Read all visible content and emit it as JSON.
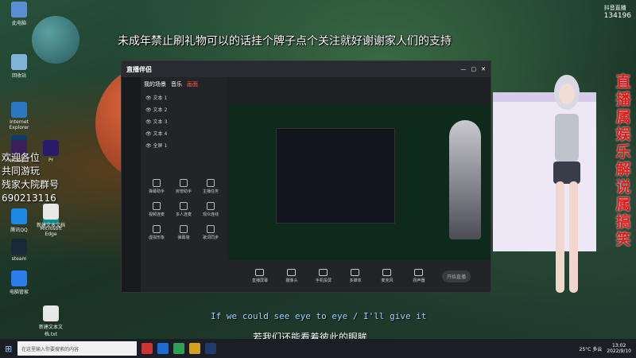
{
  "overlay": {
    "banner_top": "未成年禁止刷礼物可以的话挂个牌子点个关注就好谢谢家人们的支持",
    "left_notice": [
      "欢迎各位",
      "共同游玩",
      "残家大院群号",
      "690213116"
    ],
    "right_vertical": "直播属娱乐解说属搞笑",
    "subtitle_en": "If we could see eye to eye / I'll give it",
    "subtitle_cn": "若我们还能看着彼此的眼眸",
    "watermark_id": "134196"
  },
  "desktop_icons": [
    "此电脑",
    "回收站",
    "Internet Explorer",
    "Adobe Photosh...",
    "Ae",
    "Pr",
    "腾讯QQ",
    "Microsoft Edge",
    "新建文本文档",
    "电脑管家",
    "steam",
    "新建文本文档.txt"
  ],
  "app": {
    "logo": "直播伴侣",
    "tabs": [
      "我的场景",
      "音乐",
      "画面"
    ],
    "scene_items": [
      "文本 1",
      "文本 2",
      "文本 3",
      "文本 4",
      "全屏 1"
    ],
    "tool_items": [
      "弹幕助手",
      "房管助手",
      "主播任务",
      "视频连麦",
      "多人连麦",
      "观众连线",
      "虚拟形象",
      "弹幕墙",
      "歌词同步"
    ],
    "bottom_tools": [
      "直播屏幕",
      "摄像头",
      "手机投屏",
      "多媒体",
      "麦克风",
      "扬声器"
    ],
    "live_button": "开始直播"
  },
  "taskbar": {
    "search_placeholder": "在这里输入你要搜索的内容",
    "weather": "25°C 多云",
    "time": "13:02",
    "date": "2022/9/10"
  },
  "colors": {
    "accent_red": "#e01b1b",
    "subtitle_blue": "#9fd0ff"
  }
}
